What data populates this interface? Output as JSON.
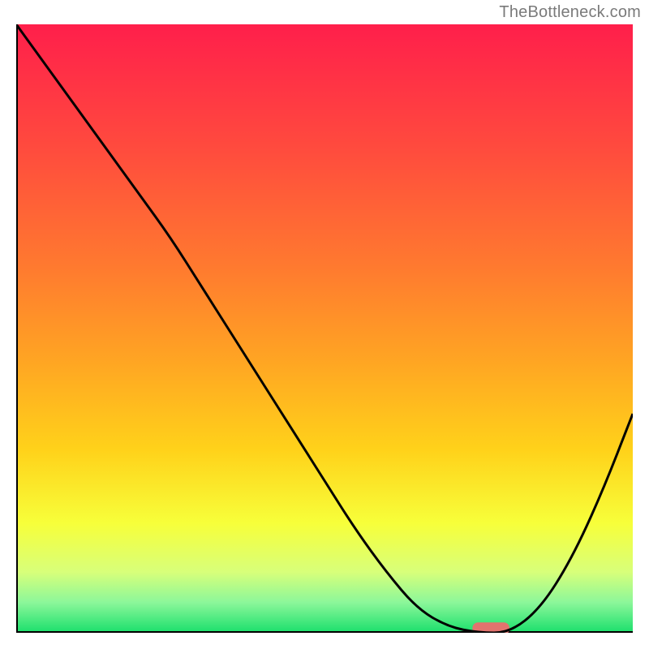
{
  "watermark": "TheBottleneck.com",
  "chart_data": {
    "type": "line",
    "title": "",
    "xlabel": "",
    "ylabel": "",
    "xlim": [
      0,
      100
    ],
    "ylim": [
      0,
      100
    ],
    "x": [
      0,
      5,
      10,
      15,
      20,
      25,
      30,
      35,
      40,
      45,
      50,
      55,
      60,
      65,
      70,
      75,
      80,
      85,
      90,
      95,
      100
    ],
    "values": [
      100,
      93,
      86,
      79,
      72,
      65,
      57,
      49,
      41,
      33,
      25,
      17,
      10,
      4,
      1,
      0,
      0,
      4,
      12,
      23,
      36
    ],
    "gradient_stops": [
      {
        "offset": 0.0,
        "color": "#ff1f4b"
      },
      {
        "offset": 0.2,
        "color": "#ff4a3e"
      },
      {
        "offset": 0.4,
        "color": "#ff7a2f"
      },
      {
        "offset": 0.55,
        "color": "#ffa423"
      },
      {
        "offset": 0.7,
        "color": "#ffd21a"
      },
      {
        "offset": 0.82,
        "color": "#f7ff3a"
      },
      {
        "offset": 0.9,
        "color": "#d8ff7a"
      },
      {
        "offset": 0.95,
        "color": "#8cf79a"
      },
      {
        "offset": 1.0,
        "color": "#1adf6c"
      }
    ],
    "marker": {
      "x_start": 74,
      "x_end": 80,
      "color": "#e2736e",
      "thickness": 2.0
    },
    "axes_color": "#000000",
    "line_color": "#000000",
    "line_width": 3
  }
}
